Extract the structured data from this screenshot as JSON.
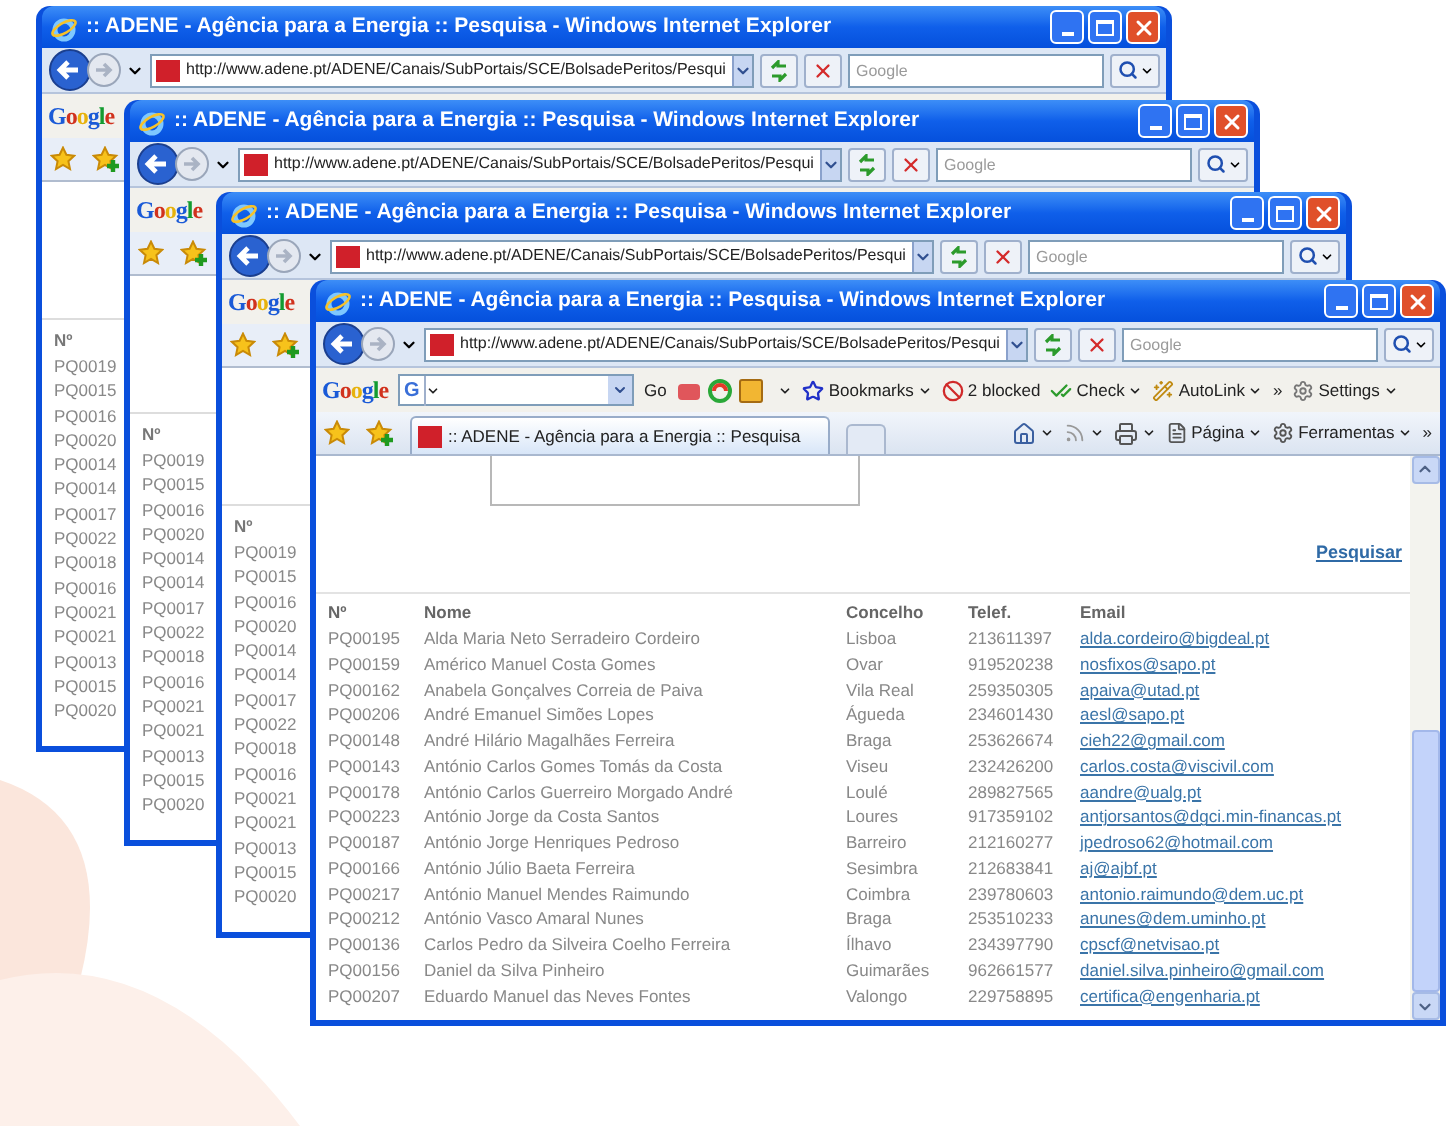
{
  "windows": [
    {
      "title": ":: ADENE - Agência para a Energia :: Pesquisa - Windows Internet Explorer",
      "address": "http://www.adene.pt/ADENE/Canais/SubPortais/SCE/BolsadePeritos/Pesqui",
      "search_placeholder": "Google",
      "google_logo": "Google",
      "id_header": "Nº",
      "ids": [
        "PQ0019",
        "PQ0015",
        "PQ0016",
        "PQ0020",
        "PQ0014",
        "PQ0014",
        "PQ0017",
        "PQ0022",
        "PQ0018",
        "PQ0016",
        "PQ0021",
        "PQ0021",
        "PQ0013",
        "PQ0015",
        "PQ0020"
      ]
    },
    {
      "title": ":: ADENE - Agência para a Energia :: Pesquisa - Windows Internet Explorer",
      "address": "http://www.adene.pt/ADENE/Canais/SubPortais/SCE/BolsadePeritos/Pesqui",
      "search_placeholder": "Google",
      "google_logo": "Google",
      "id_header": "Nº",
      "ids": [
        "PQ0019",
        "PQ0015",
        "PQ0016",
        "PQ0020",
        "PQ0014",
        "PQ0014",
        "PQ0017",
        "PQ0022",
        "PQ0018",
        "PQ0016",
        "PQ0021",
        "PQ0021",
        "PQ0013",
        "PQ0015",
        "PQ0020"
      ]
    },
    {
      "title": ":: ADENE - Agência para a Energia :: Pesquisa - Windows Internet Explorer",
      "address": "http://www.adene.pt/ADENE/Canais/SubPortais/SCE/BolsadePeritos/Pesqui",
      "search_placeholder": "Google",
      "google_logo": "Google",
      "id_header": "Nº",
      "ids": [
        "PQ0019",
        "PQ0015",
        "PQ0016",
        "PQ0020",
        "PQ0014",
        "PQ0014",
        "PQ0017",
        "PQ0022",
        "PQ0018",
        "PQ0016",
        "PQ0021",
        "PQ0021",
        "PQ0013",
        "PQ0015",
        "PQ0020"
      ]
    }
  ],
  "front_window": {
    "title": ":: ADENE - Agência para a Energia :: Pesquisa - Windows Internet Explorer",
    "address": "http://www.adene.pt/ADENE/Canais/SubPortais/SCE/BolsadePeritos/Pesqui",
    "search_placeholder": "Google",
    "google_toolbar": {
      "logo": "Google",
      "engine": "G",
      "go": "Go",
      "bookmarks": "Bookmarks",
      "blocked": "2 blocked",
      "check": "Check",
      "autolink": "AutoLink",
      "more": "»",
      "settings": "Settings"
    },
    "tab": {
      "title": ":: ADENE - Agência para a Energia :: Pesquisa"
    },
    "command_bar": {
      "page": "Página",
      "tools": "Ferramentas",
      "more": "»"
    },
    "search_link": "Pesquisar",
    "table": {
      "columns": [
        "Nº",
        "Nome",
        "Concelho",
        "Telef.",
        "Email"
      ],
      "rows": [
        [
          "PQ00195",
          "Alda Maria Neto Serradeiro Cordeiro",
          "Lisboa",
          "213611397",
          "alda.cordeiro@bigdeal.pt"
        ],
        [
          "PQ00159",
          "Américo Manuel Costa Gomes",
          "Ovar",
          "919520238",
          "nosfixos@sapo.pt"
        ],
        [
          "PQ00162",
          "Anabela Gonçalves Correia de Paiva",
          "Vila Real",
          "259350305",
          "apaiva@utad.pt"
        ],
        [
          "PQ00206",
          "André Emanuel Simões Lopes",
          "Águeda",
          "234601430",
          "aesl@sapo.pt"
        ],
        [
          "PQ00148",
          "André Hilário Magalhães Ferreira",
          "Braga",
          "253626674",
          "cieh22@gmail.com"
        ],
        [
          "PQ00143",
          "António Carlos Gomes Tomás da Costa",
          "Viseu",
          "232426200",
          "carlos.costa@viscivil.com"
        ],
        [
          "PQ00178",
          "António Carlos Guerreiro Morgado André",
          "Loulé",
          "289827565",
          "aandre@ualg.pt"
        ],
        [
          "PQ00223",
          "António Jorge da Costa Santos",
          "Loures",
          "917359102",
          "antjorsantos@dgci.min-financas.pt"
        ],
        [
          "PQ00187",
          "António Jorge Henriques Pedroso",
          "Barreiro",
          "212160277",
          "jpedroso62@hotmail.com"
        ],
        [
          "PQ00166",
          "António Júlio Baeta Ferreira",
          "Sesimbra",
          "212683841",
          "aj@ajbf.pt"
        ],
        [
          "PQ00217",
          "António Manuel Mendes Raimundo",
          "Coimbra",
          "239780603",
          "antonio.raimundo@dem.uc.pt"
        ],
        [
          "PQ00212",
          "António Vasco Amaral Nunes",
          "Braga",
          "253510233",
          "anunes@dem.uminho.pt"
        ],
        [
          "PQ00136",
          "Carlos Pedro da Silveira Coelho Ferreira",
          "Ílhavo",
          "234397790",
          "cpscf@netvisao.pt"
        ],
        [
          "PQ00156",
          "Daniel da Silva Pinheiro",
          "Guimarães",
          "962661577",
          "daniel.silva.pinheiro@gmail.com"
        ],
        [
          "PQ00207",
          "Eduardo Manuel das Neves Fontes",
          "Valongo",
          "229758895",
          "certifica@engenharia.pt"
        ]
      ]
    }
  }
}
